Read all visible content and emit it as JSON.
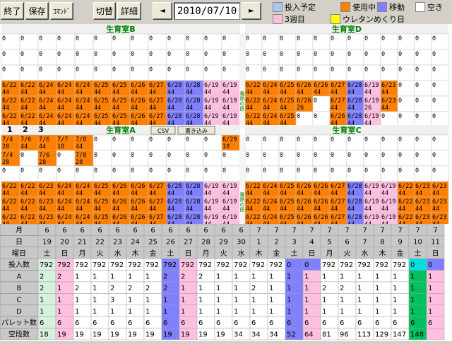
{
  "toolbar": {
    "exit": "終了",
    "save": "保存",
    "command": "ｺﾏﾝﾄﾞ",
    "switch": "切替",
    "detail": "詳細",
    "prev": "◄",
    "next": "►",
    "date": "2010/07/10"
  },
  "legend": {
    "items": [
      {
        "label": "投入予定",
        "color": "#a8c8f0"
      },
      {
        "label": "使用中",
        "color": "#ff8000"
      },
      {
        "label": "移動",
        "color": "#8080ff"
      },
      {
        "label": "空き",
        "color": "#ffffff"
      },
      {
        "label": "3週目",
        "color": "#ffc0e0"
      },
      {
        "label": "ウレタンめくり日",
        "color": "#ffff00"
      }
    ]
  },
  "rooms": {
    "top_left": {
      "title": "生育室B"
    },
    "top_right": {
      "title": "生育室D"
    },
    "bottom_left": {
      "title": "生育室A"
    },
    "bottom_right": {
      "title": "生育室C"
    },
    "vertical_label_upper": "普通の段",
    "vertical_label_lower": "電熱の段",
    "tabs": [
      "1",
      "2",
      "3"
    ],
    "csv_button": "CSV",
    "write_button": "書き込み"
  },
  "colors": {
    "orange": "#ff8000",
    "blue": "#8080ff",
    "pink": "#ffc0e0",
    "green": "#00c060",
    "cyan": "#00e0e0",
    "header": "#c8c8c8",
    "light_green": "#d8f0e0"
  },
  "table": {
    "row_labels": [
      "月",
      "日",
      "曜日",
      "投入数",
      "A",
      "B",
      "C",
      "D",
      "パレット数",
      "空段数"
    ],
    "months": [
      "6",
      "6",
      "6",
      "6",
      "6",
      "6",
      "6",
      "6",
      "6",
      "6",
      "6",
      "6",
      "7",
      "7",
      "7",
      "7",
      "7",
      "7",
      "7",
      "7",
      "7",
      "7",
      "7",
      "7"
    ],
    "days": [
      "19",
      "20",
      "21",
      "22",
      "23",
      "24",
      "25",
      "26",
      "27",
      "28",
      "29",
      "30",
      "1",
      "2",
      "3",
      "4",
      "5",
      "6",
      "7",
      "8",
      "9",
      "10",
      "11"
    ],
    "weekdays": [
      "土",
      "日",
      "月",
      "火",
      "水",
      "木",
      "金",
      "土",
      "日",
      "月",
      "火",
      "水",
      "木",
      "金",
      "土",
      "日",
      "月",
      "火",
      "水",
      "木",
      "金",
      "土",
      "日"
    ],
    "input": [
      "792",
      "792",
      "792",
      "792",
      "792",
      "792",
      "792",
      "792",
      "792",
      "792",
      "792",
      "792",
      "792",
      "792",
      "0",
      "0",
      "792",
      "792",
      "792",
      "792",
      "792",
      "0",
      "0"
    ],
    "A": [
      "2",
      "2",
      "1",
      "1",
      "1",
      "1",
      "1",
      "2",
      "2",
      "2",
      "1",
      "1",
      "1",
      "1",
      "1",
      "1",
      "1",
      "1",
      "1",
      "1",
      "1",
      "1",
      "1"
    ],
    "B": [
      "2",
      "1",
      "2",
      "1",
      "2",
      "2",
      "2",
      "2",
      "1",
      "1",
      "1",
      "1",
      "2",
      "1",
      "1",
      "1",
      "2",
      "2",
      "1",
      "1",
      "1",
      "1",
      "1"
    ],
    "C": [
      "1",
      "1",
      "1",
      "1",
      "3",
      "1",
      "1",
      "1",
      "1",
      "1",
      "1",
      "1",
      "1",
      "1",
      "1",
      "1",
      "1",
      "1",
      "1",
      "1",
      "1",
      "1",
      "1"
    ],
    "D": [
      "1",
      "1",
      "1",
      "1",
      "1",
      "1",
      "1",
      "1",
      "1",
      "1",
      "1",
      "1",
      "1",
      "1",
      "1",
      "1",
      "1",
      "1",
      "1",
      "1",
      "1",
      "1",
      "1"
    ],
    "pallet": [
      "6",
      "6",
      "6",
      "6",
      "6",
      "6",
      "6",
      "6",
      "6",
      "6",
      "6",
      "6",
      "6",
      "6",
      "6",
      "6",
      "6",
      "6",
      "6",
      "6",
      "6",
      "6",
      "6"
    ],
    "empty": [
      "18",
      "19",
      "19",
      "19",
      "19",
      "19",
      "19",
      "19",
      "19",
      "19",
      "19",
      "34",
      "34",
      "34",
      "52",
      "64",
      "81",
      "96",
      "113",
      "129",
      "147",
      "148",
      ""
    ]
  },
  "grid": {
    "top_left_rows": [
      [
        "0",
        "0",
        "0",
        "0",
        "0",
        "0",
        "0",
        "0",
        "0",
        "0",
        "0",
        "0",
        "0"
      ],
      [
        "0",
        "0",
        "0",
        "0",
        "0",
        "0",
        "0",
        "0",
        "0",
        "0",
        "0",
        "0",
        "0"
      ],
      [
        "0",
        "0",
        "0",
        "0",
        "0",
        "0",
        "0",
        "0",
        "0",
        "0",
        "0",
        "0",
        "0"
      ],
      [
        "6/22 44",
        "6/22 44",
        "6/24 44",
        "6/24 44",
        "6/24 44",
        "6/25 44",
        "6/25 44",
        "6/26 44",
        "6/27 44",
        "6/28 44",
        "6/28 44",
        "6/19 44",
        "6/19 44"
      ],
      [
        "6/22 44",
        "6/22 44",
        "6/24 44",
        "6/24 44",
        "6/24 44",
        "6/25 44",
        "6/25 44",
        "6/26 44",
        "6/27 44",
        "6/28 44",
        "6/28 44",
        "6/19 44",
        "6/19 44"
      ],
      [
        "6/22 44",
        "6/22 44",
        "6/24 44",
        "6/24 44",
        "6/24 44",
        "6/25 44",
        "6/25 44",
        "6/26 44",
        "6/27 44",
        "6/28 44",
        "6/28 44",
        "6/19 44",
        "6/19 44"
      ]
    ],
    "top_right_rows": [
      [
        "0",
        "0",
        "0",
        "0",
        "0",
        "0",
        "0",
        "0",
        "0",
        "0",
        "0",
        "0"
      ],
      [
        "0",
        "0",
        "0",
        "0",
        "0",
        "0",
        "0",
        "0",
        "0",
        "0",
        "0",
        "0"
      ],
      [
        "0",
        "0",
        "0",
        "0",
        "0",
        "0",
        "0",
        "0",
        "0",
        "0",
        "0",
        "0"
      ],
      [
        "6/22 44",
        "6/24 44",
        "6/25 44",
        "6/26 44",
        "6/26 44",
        "6/27 44",
        "6/28 44",
        "6/19 44",
        "6/23 44",
        "0",
        "0",
        "0"
      ],
      [
        "6/22 44",
        "6/24 44",
        "6/25 44",
        "6/26 26",
        "0",
        "6/27 44",
        "6/28 44",
        "6/19 26",
        "6/23 44",
        "0",
        "0",
        "0"
      ],
      [
        "6/22 44",
        "6/24 44",
        "6/25 44",
        "0",
        "0",
        "6/26 44",
        "6/28 44",
        "6/19 44",
        "0",
        "0",
        "0",
        "0"
      ]
    ],
    "bottom_left_rows": [
      [
        "7/4 28",
        "7/6 44",
        "7/6 44",
        "7/7 18",
        "7/8 44",
        "0",
        "0",
        "0",
        "0",
        "0",
        "0",
        "0",
        "6/29 18"
      ],
      [
        "7/4 28",
        "0",
        "7/6 28",
        "0",
        "7/8 28",
        "0",
        "0",
        "0",
        "0",
        "0",
        "0",
        "0",
        "0"
      ],
      [
        "0",
        "0",
        "0",
        "0",
        "0",
        "0",
        "0",
        "0",
        "0",
        "0",
        "0",
        "0",
        "0"
      ],
      [
        "6/22 44",
        "6/22 44",
        "6/23 44",
        "6/24 44",
        "6/24 44",
        "6/25 44",
        "6/26 44",
        "6/26 44",
        "6/27 44",
        "6/28 44",
        "6/28 44",
        "6/19 44",
        "6/19 44"
      ],
      [
        "6/22 44",
        "6/22 44",
        "6/23 44",
        "6/24 44",
        "6/24 44",
        "6/25 44",
        "6/26 44",
        "6/26 44",
        "6/27 44",
        "6/28 44",
        "6/28 44",
        "6/19 44",
        "6/19 44"
      ],
      [
        "6/22 44",
        "6/22 44",
        "6/23 44",
        "6/24 44",
        "6/24 44",
        "6/25 44",
        "6/26 44",
        "6/26 44",
        "6/27 44",
        "6/28 44",
        "6/28 44",
        "6/19 44",
        "6/19 44"
      ]
    ],
    "bottom_right_rows": [
      [
        "0",
        "0",
        "0",
        "0",
        "0",
        "0",
        "0",
        "0",
        "0",
        "0",
        "0",
        "0"
      ],
      [
        "0",
        "0",
        "0",
        "0",
        "0",
        "0",
        "0",
        "0",
        "0",
        "0",
        "0",
        "0"
      ],
      [
        "0",
        "0",
        "0",
        "0",
        "0",
        "0",
        "0",
        "0",
        "0",
        "0",
        "0",
        "0"
      ],
      [
        "6/22 44",
        "6/24 44",
        "6/25 44",
        "6/26 44",
        "6/26 44",
        "6/27 44",
        "6/28 44",
        "6/19 44",
        "6/19 44",
        "6/22 44",
        "6/23 44",
        "6/23 44"
      ],
      [
        "6/22 44",
        "6/24 44",
        "6/25 44",
        "6/26 44",
        "6/26 44",
        "6/27 44",
        "6/28 44",
        "6/19 44",
        "6/19 44",
        "6/22 44",
        "6/23 44",
        "6/23 44"
      ],
      [
        "6/22 44",
        "6/24 44",
        "6/25 44",
        "6/26 44",
        "6/26 44",
        "6/27 44",
        "6/28 44",
        "6/19 44",
        "6/19 44",
        "6/22 44",
        "6/23 44",
        "6/23 44"
      ]
    ]
  }
}
